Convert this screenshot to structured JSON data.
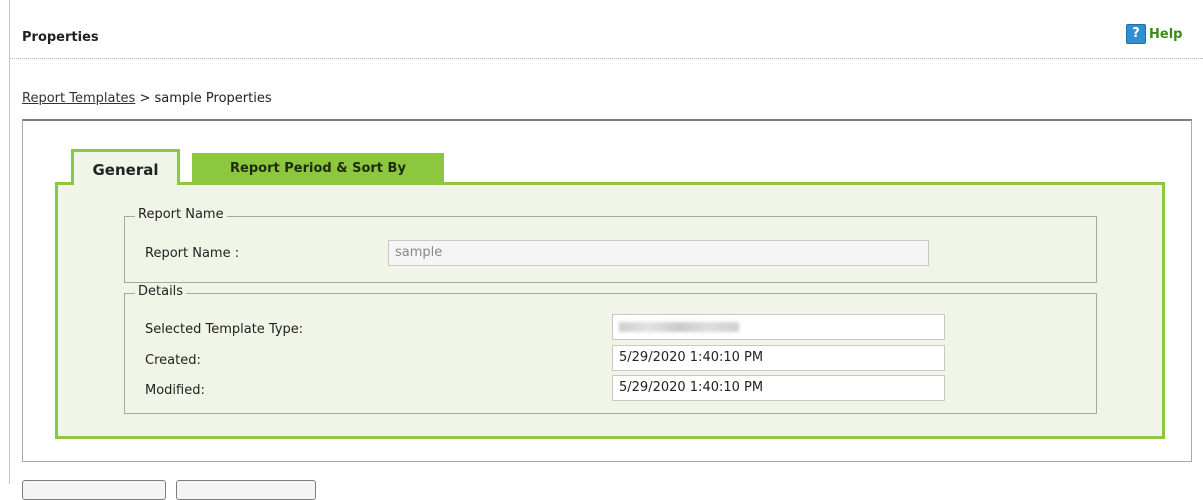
{
  "header": {
    "title": "Properties",
    "help_label": "Help"
  },
  "breadcrumb": {
    "link": "Report Templates",
    "separator": ">",
    "current": "sample Properties"
  },
  "tabs": [
    {
      "label": "General",
      "active": true
    },
    {
      "label": "Report Period & Sort By",
      "active": false
    }
  ],
  "report_name_group": {
    "legend": "Report Name",
    "label": "Report Name :",
    "value": "sample"
  },
  "details_group": {
    "legend": "Details",
    "rows": [
      {
        "label": "Selected Template Type:",
        "value": ""
      },
      {
        "label": "Created:",
        "value": "5/29/2020 1:40:10 PM"
      },
      {
        "label": "Modified:",
        "value": "5/29/2020 1:40:10 PM"
      }
    ]
  },
  "colors": {
    "tab_accent": "#8dc63f",
    "panel_bg": "#f0f5e8",
    "help_text": "#3b8a1c",
    "help_icon": "#2f8fd0"
  },
  "icons": {
    "help": "question-mark-icon"
  }
}
